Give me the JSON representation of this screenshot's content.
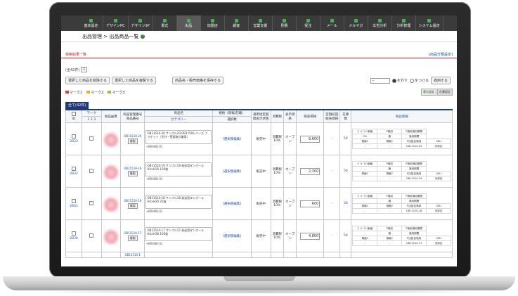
{
  "nav": {
    "items": [
      {
        "label": "基本設定",
        "active": false
      },
      {
        "label": "デザインPC",
        "active": false
      },
      {
        "label": "デザインSP",
        "active": false
      },
      {
        "label": "書式",
        "active": false
      },
      {
        "label": "出品",
        "active": true
      },
      {
        "label": "加盟店",
        "active": false
      },
      {
        "label": "顧客",
        "active": false
      },
      {
        "label": "営業支援",
        "active": false
      },
      {
        "label": "見積",
        "active": false
      },
      {
        "label": "受注",
        "active": false
      },
      {
        "label": "メール",
        "active": false
      },
      {
        "label": "メルマガ",
        "active": false
      },
      {
        "label": "広告分析",
        "active": false
      },
      {
        "label": "分析管理",
        "active": false
      },
      {
        "label": "システム設定",
        "active": false
      }
    ],
    "icon_color": "#4caf50"
  },
  "breadcrumb": {
    "text": "出品管理 > 出品商品一覧",
    "help": "?"
  },
  "section": {
    "title": "検索結果一覧",
    "right_link": "[商品分類設定]"
  },
  "result": {
    "count_label": "(全42件)",
    "page": "1"
  },
  "actions": {
    "delete_selected": "選択した商品を削除する",
    "copy_selected": "選択した商品を複製する",
    "save_name_price": "商品名・販売価格を保存する",
    "select_value": "--",
    "radio_remove": "を外す",
    "radio_add": "をつける",
    "apply": "適用する"
  },
  "marks": {
    "items": [
      {
        "label": "マーク1",
        "color": "#e53935"
      },
      {
        "label": "マーク2",
        "color": "#f0b400"
      },
      {
        "label": "マーク3",
        "color": "#8bc34a"
      }
    ],
    "btn_display": "表示設定",
    "btn_other": "在庫設定"
  },
  "table": {
    "all_tag": "全て(42件)",
    "headers": {
      "check": "□",
      "id": "ID",
      "mark": "マーク",
      "mark_nums": [
        "1",
        "2",
        "3"
      ],
      "image": "商品画像",
      "code": "商品管理番号 商品番号",
      "name": "商品名",
      "category": "カテゴリー",
      "spec": "規格（情報/記載）",
      "select_count": "選択数",
      "status": "適用指定期間表示状態",
      "tax": "消費税",
      "display": "表示価格",
      "price": "販売価格",
      "prev_price": "定期初回販売価格",
      "stock": "在庫数",
      "info": "商品情報"
    },
    "rows": [
      {
        "id": "2833",
        "code": "OB11510-20",
        "name": "OB11510-20 サンプル20 OB1159シリーズ ブラケット（天井・壁面取付兼用）",
        "brand": "+BRAND-01",
        "spec_link": "[選択肢編集]",
        "status": "販売中",
        "tax": "消費税 10%",
        "display": "オープン",
        "price": "9,600",
        "prev": "-",
        "stock": "50",
        "edit": "複製",
        "info": [
          [
            "ｶﾞｲﾄﾞﾗｲﾝ価格",
            "P適用",
            "P適用適用期間"
          ],
          [
            "0%",
            "通",
            "適用期間"
          ],
          [
            "規格1",
            "規格2",
            "P店独自適用",
            "SKU"
          ],
          [
            "-",
            "-",
            "OB11510-20",
            "未設定"
          ]
        ]
      },
      {
        "id": "2832",
        "code": "OB11510-19",
        "name": "OB11510-19 サンプル19 発送用ダンボール A4×H25 100枚",
        "brand": "+BRAND-01",
        "spec_link": "[選択肢編集]",
        "status": "販売中",
        "tax": "消費税 10%",
        "display": "オープン",
        "price": "2,300",
        "prev": "-",
        "stock": "50",
        "edit": "複製",
        "info": [
          [
            "ｶﾞｲﾄﾞﾗｲﾝ価格",
            "P適用",
            "P適用適用期間"
          ],
          [
            "-",
            "通",
            "適用期間"
          ],
          [
            "規格1",
            "規格2",
            "P店独自適用",
            "SKU"
          ],
          [
            "-",
            "-",
            "OB11510-19",
            "未設定"
          ]
        ]
      },
      {
        "id": "2831",
        "code": "OB11510-18",
        "name": "OB11510-18 サンプル18 発送用ダンボール A4×H25 25枚",
        "brand": "+BRAND-01",
        "spec_link": "[選択肢編集]",
        "status": "販売中",
        "tax": "消費税 10%",
        "display": "オープン",
        "price": "600",
        "prev": "-",
        "stock": "50",
        "edit": "複製",
        "info": [
          [
            "ｶﾞｲﾄﾞﾗｲﾝ価格",
            "P適用",
            "P適用適用期間"
          ],
          [
            "-",
            "通",
            "適用期間"
          ],
          [
            "規格1",
            "規格2",
            "P店独自適用",
            "SKU"
          ],
          [
            "-",
            "-",
            "OB11510-18",
            "未設定"
          ]
        ]
      },
      {
        "id": "2830",
        "code": "OB11510-17",
        "name": "OB11510-17 サンプル17 発送用ダンボール A4×H30 100枚",
        "brand": "+BRAND-01",
        "spec_link": "[選択肢編集]",
        "status": "販売中",
        "tax": "消費税 10%",
        "display": "オープン",
        "price": "4,800",
        "prev": "-",
        "stock": "50",
        "edit": "複製",
        "info": [
          [
            "ｶﾞｲﾄﾞﾗｲﾝ価格",
            "P適用",
            "P適用適用期間"
          ],
          [
            "-",
            "通",
            "適用期間"
          ],
          [
            "規格1",
            "規格2",
            "P店独自適用",
            "SKU"
          ],
          [
            "-",
            "-",
            "OB11510-17",
            "未設定"
          ]
        ]
      }
    ],
    "partial_code": "OB11510-1"
  },
  "colors": {
    "accent_red": "#c62828",
    "link_blue": "#1a4fa0",
    "header_navy": "#1e3a78"
  }
}
